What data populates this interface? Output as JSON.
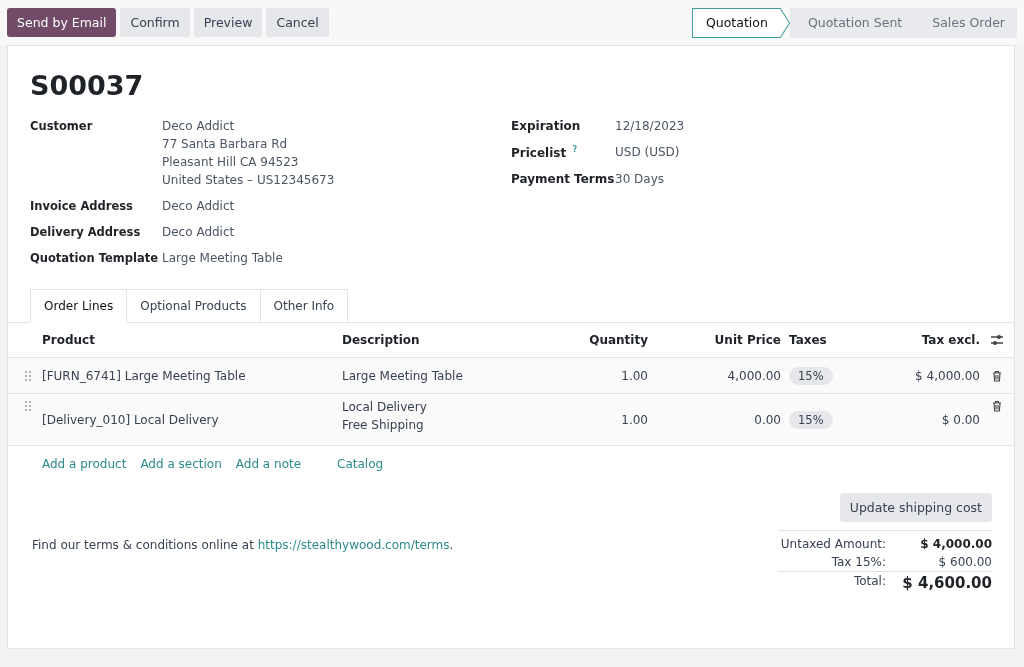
{
  "actions": [
    {
      "label": "Send by Email",
      "primary": true
    },
    {
      "label": "Confirm",
      "primary": false
    },
    {
      "label": "Preview",
      "primary": false
    },
    {
      "label": "Cancel",
      "primary": false
    }
  ],
  "stages": [
    {
      "label": "Quotation",
      "selected": true
    },
    {
      "label": "Quotation Sent",
      "selected": false
    },
    {
      "label": "Sales Order",
      "selected": false
    }
  ],
  "title": "S00037",
  "left_fields": [
    {
      "label": "Customer",
      "lines": [
        "Deco Addict",
        "77 Santa Barbara Rd",
        "Pleasant Hill CA 94523",
        "United States – US12345673"
      ]
    },
    {
      "label": "Invoice Address",
      "lines": [
        "Deco Addict"
      ]
    },
    {
      "label": "Delivery Address",
      "lines": [
        "Deco Addict"
      ]
    },
    {
      "label": "Quotation Template",
      "lines": [
        "Large Meeting Table"
      ]
    }
  ],
  "right_fields": [
    {
      "label": "Expiration",
      "value": "12/18/2023"
    },
    {
      "label": "Pricelist",
      "help_mark": "?",
      "value": "USD (USD)"
    },
    {
      "label": "Payment Terms",
      "value": "30 Days"
    }
  ],
  "tabs": [
    {
      "label": "Order Lines",
      "selected": true
    },
    {
      "label": "Optional Products",
      "selected": false
    },
    {
      "label": "Other Info",
      "selected": false
    }
  ],
  "table": {
    "columns": [
      "Product",
      "Description",
      "Quantity",
      "Unit Price",
      "Taxes",
      "Tax excl."
    ],
    "rows": [
      {
        "product": "[FURN_6741] Large Meeting Table",
        "description": [
          "Large Meeting Table"
        ],
        "quantity": "1.00",
        "unit_price": "4,000.00",
        "taxes": "15%",
        "tax_excl": "$ 4,000.00"
      },
      {
        "product": "[Delivery_010] Local Delivery",
        "description": [
          "Local Delivery",
          "Free Shipping"
        ],
        "quantity": "1.00",
        "unit_price": "0.00",
        "taxes": "15%",
        "tax_excl": "$ 0.00"
      }
    ]
  },
  "add_links": [
    "Add a product",
    "Add a section",
    "Add a note",
    "Catalog"
  ],
  "update_button": "Update shipping cost",
  "terms": {
    "before": "Find our terms & conditions online at ",
    "link": "https://stealthywood.com/terms",
    "after": "."
  },
  "totals": [
    {
      "label": "Untaxed Amount:",
      "value": "$ 4,000.00",
      "kind": "subtotal"
    },
    {
      "label": "Tax 15%:",
      "value": "$ 600.00",
      "kind": "tax"
    },
    {
      "label": "Total:",
      "value": "$ 4,600.00",
      "kind": "total"
    }
  ]
}
